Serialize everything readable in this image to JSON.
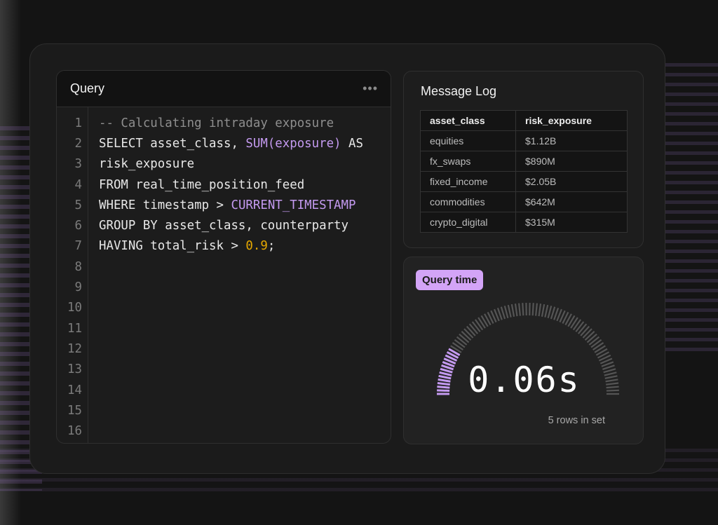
{
  "query": {
    "title": "Query",
    "menu_icon": "more-horizontal-icon",
    "menu_label": "•••",
    "lines": [
      [
        {
          "t": "-- Calculating intraday exposure",
          "k": "comment"
        }
      ],
      [
        {
          "t": "SELECT asset_class, ",
          "k": "plain"
        },
        {
          "t": "SUM(exposure)",
          "k": "fn"
        },
        {
          "t": " AS",
          "k": "plain"
        }
      ],
      [
        {
          "t": "risk_exposure",
          "k": "plain"
        }
      ],
      [
        {
          "t": "FROM real_time_position_feed",
          "k": "plain"
        }
      ],
      [
        {
          "t": "WHERE timestamp > ",
          "k": "plain"
        },
        {
          "t": "CURRENT_TIMESTAMP",
          "k": "fn"
        }
      ],
      [
        {
          "t": "GROUP BY asset_class, counterparty",
          "k": "plain"
        }
      ],
      [
        {
          "t": "HAVING total_risk > ",
          "k": "plain"
        },
        {
          "t": "0.9",
          "k": "num"
        },
        {
          "t": ";",
          "k": "plain"
        }
      ],
      [],
      [],
      [],
      [],
      [],
      [],
      [],
      [],
      []
    ]
  },
  "message_log": {
    "title": "Message Log",
    "columns": [
      "asset_class",
      "risk_exposure"
    ],
    "rows": [
      [
        "equities",
        "$1.12B"
      ],
      [
        "fx_swaps",
        "$890M"
      ],
      [
        "fixed_income",
        "$2.05B"
      ],
      [
        "commodities",
        "$642M"
      ],
      [
        "crypto_digital",
        "$315M"
      ]
    ]
  },
  "query_time": {
    "badge": "Query time",
    "value": "0.06s",
    "rows_label": "5 rows in set",
    "gauge_fraction": 0.17,
    "accent": "#c49af0",
    "track": "#555555"
  }
}
